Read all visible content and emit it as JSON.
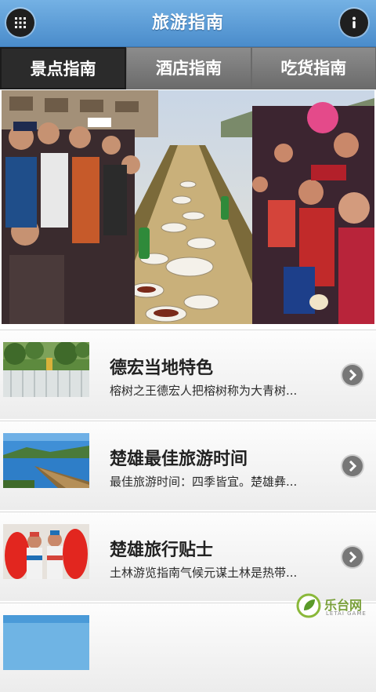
{
  "header": {
    "title": "旅游指南",
    "menu_icon": "grid-menu-icon",
    "info_icon": "info-icon",
    "colors": {
      "bar_top": "#74b1e4",
      "bar_bottom": "#4a8ccb",
      "button": "#1f1f1f"
    }
  },
  "tabs": [
    {
      "label": "景点指南",
      "active": true
    },
    {
      "label": "酒店指南",
      "active": false
    },
    {
      "label": "吃货指南",
      "active": false
    }
  ],
  "list": {
    "items": [
      {
        "title": "德宏当地特色",
        "desc": "榕树之王德宏人把榕树称为大青树..."
      },
      {
        "title": "楚雄最佳旅游时间",
        "desc": "最佳旅游时间：四季皆宜。楚雄彝..."
      },
      {
        "title": "楚雄旅行贴士",
        "desc": "土林游览指南气候元谋土林是热带..."
      }
    ],
    "arrow_icon": "chevron-right-icon"
  },
  "watermark": {
    "text": "乐台网",
    "sub": "LETAI GAME"
  }
}
